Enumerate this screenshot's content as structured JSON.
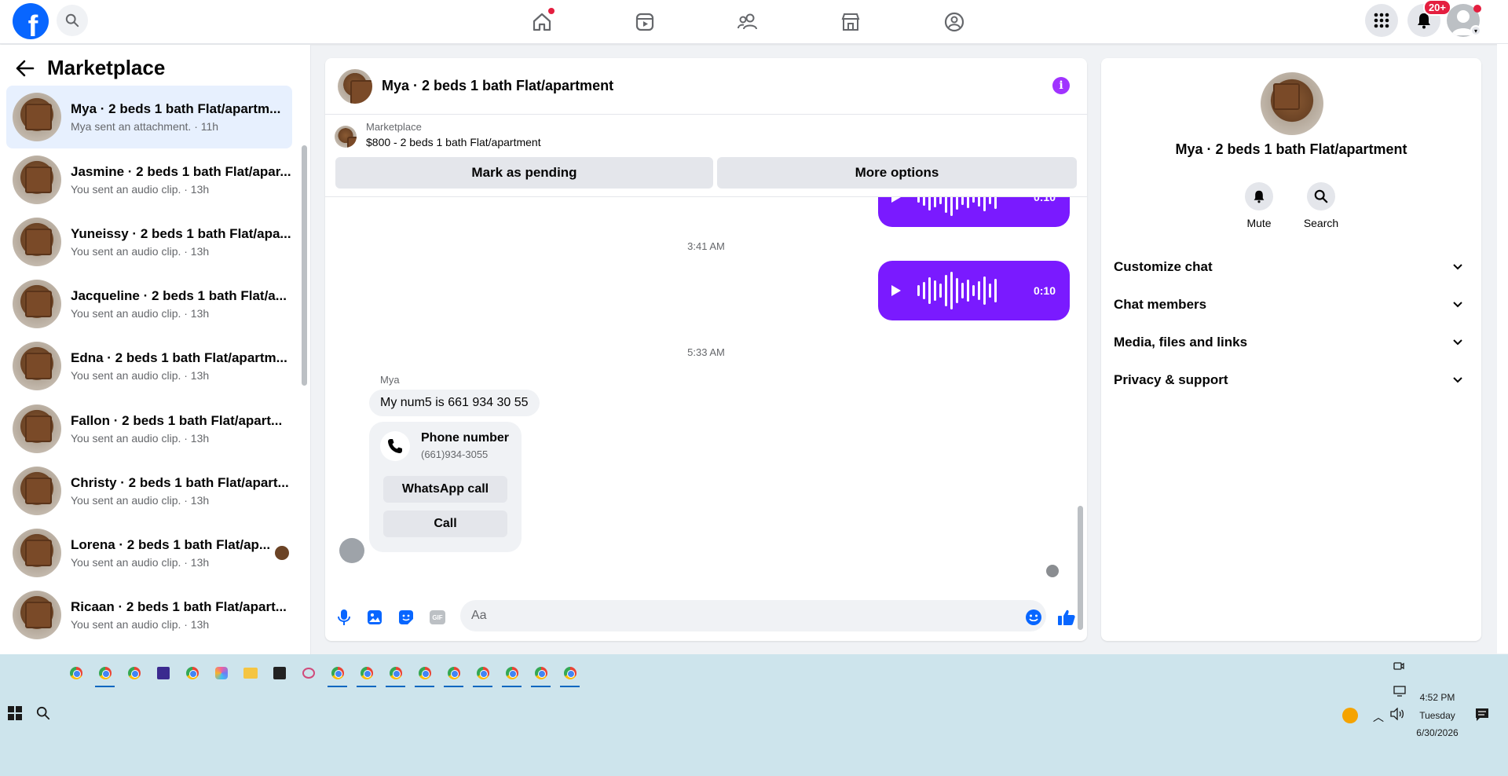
{
  "topbar": {
    "logo_letter": "f",
    "notification_badge": "20+"
  },
  "sidebar": {
    "title": "Marketplace",
    "conversations": [
      {
        "name": "Mya · 2 beds 1 bath Flat/apartm...",
        "sub": "Mya sent an attachment. · 11h"
      },
      {
        "name": "Jasmine · 2 beds 1 bath Flat/apar...",
        "sub": "You sent an audio clip. · 13h"
      },
      {
        "name": "Yuneissy · 2 beds 1 bath Flat/apa...",
        "sub": "You sent an audio clip. · 13h"
      },
      {
        "name": "Jacqueline · 2 beds 1 bath Flat/a...",
        "sub": "You sent an audio clip. · 13h"
      },
      {
        "name": "Edna · 2 beds 1 bath Flat/apartm...",
        "sub": "You sent an audio clip. · 13h"
      },
      {
        "name": "Fallon · 2 beds 1 bath Flat/apart...",
        "sub": "You sent an audio clip. · 13h"
      },
      {
        "name": "Christy · 2 beds 1 bath Flat/apart...",
        "sub": "You sent an audio clip. · 13h"
      },
      {
        "name": "Lorena · 2 beds 1 bath Flat/ap...",
        "sub": "You sent an audio clip. · 13h"
      },
      {
        "name": "Ricaan · 2 beds 1 bath Flat/apart...",
        "sub": "You sent an audio clip. · 13h"
      }
    ]
  },
  "chat": {
    "title": "Mya · 2 beds 1 bath Flat/apartment",
    "listing_source": "Marketplace",
    "listing_title": "$800 - 2 beds 1 bath Flat/apartment",
    "mark_pending_label": "Mark as pending",
    "more_options_label": "More options",
    "audio_duration_1": "0:10",
    "timestamp_1": "3:41 AM",
    "audio_duration_2": "0:10",
    "timestamp_2": "5:33 AM",
    "sender_name": "Mya",
    "message_text": "My num5 is 661 934 30 55",
    "card_title": "Phone number",
    "card_number": "(661)934-3055",
    "whatsapp_label": "WhatsApp call",
    "call_label": "Call",
    "composer_placeholder": "Aa",
    "gif_label": "GIF"
  },
  "right_panel": {
    "name": "Mya · 2 beds 1 bath Flat/apartment",
    "mute_label": "Mute",
    "search_label": "Search",
    "sections": [
      "Customize chat",
      "Chat members",
      "Media, files and links",
      "Privacy & support"
    ]
  },
  "taskbar": {
    "time": "4:52 PM",
    "day": "Tuesday",
    "date": "6/30/2026"
  },
  "colors": {
    "brand": "#0866ff",
    "audio_bubble": "#7a1aff",
    "info": "#a033ff",
    "active_conversation": "#e7f0fe"
  }
}
